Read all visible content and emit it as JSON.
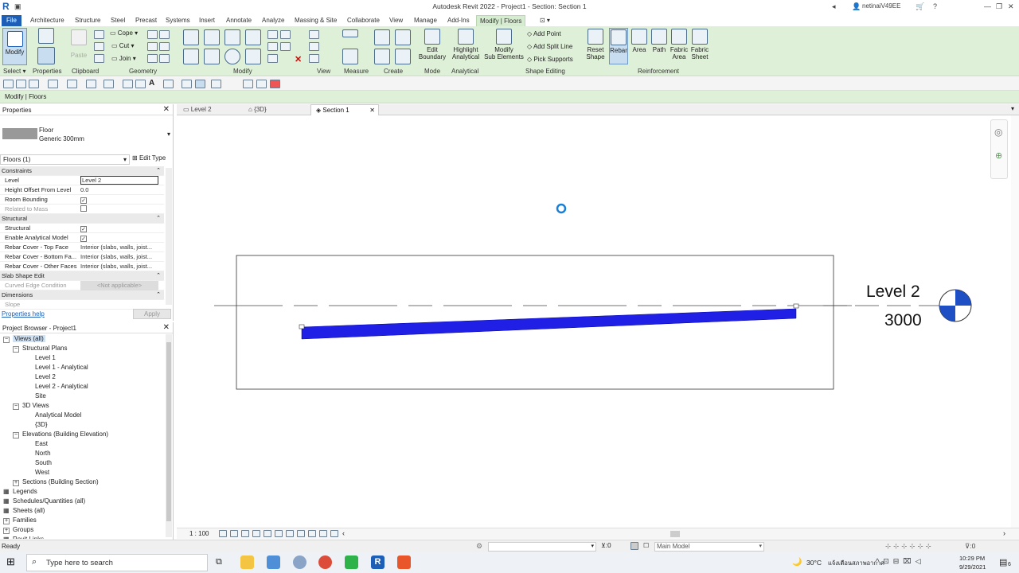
{
  "window": {
    "title": "Autodesk Revit 2022 - Project1 - Section: Section 1",
    "app_logo": "R",
    "user": "netinaiV49EE"
  },
  "menu": {
    "tabs": [
      "File",
      "Architecture",
      "Structure",
      "Steel",
      "Precast",
      "Systems",
      "Insert",
      "Annotate",
      "Analyze",
      "Massing & Site",
      "Collaborate",
      "View",
      "Manage",
      "Add-Ins",
      "Modify | Floors"
    ],
    "active": "Modify | Floors"
  },
  "ribbon": {
    "modify": "Modify",
    "paste": "Paste",
    "cope": "Cope",
    "cut": "Cut",
    "join": "Join",
    "edit_boundary": [
      "Edit",
      "Boundary"
    ],
    "highlight_analytical": [
      "Highlight",
      "Analytical"
    ],
    "modify_sub": [
      "Modify",
      "Sub Elements"
    ],
    "add_point": "Add Point",
    "add_split_line": "Add Split Line",
    "pick_supports": "Pick Supports",
    "reset_shape": [
      "Reset",
      "Shape"
    ],
    "rebar": "Rebar",
    "area": "Area",
    "path": "Path",
    "fabric_area": [
      "Fabric",
      "Area"
    ],
    "fabric_sheet": [
      "Fabric",
      "Sheet"
    ],
    "panels": {
      "select": "Select",
      "properties": "Properties",
      "clipboard": "Clipboard",
      "geometry": "Geometry",
      "modify": "Modify",
      "view": "View",
      "measure": "Measure",
      "create": "Create",
      "mode": "Mode",
      "analytical": "Analytical",
      "shape_editing": "Shape Editing",
      "reinforcement": "Reinforcement"
    }
  },
  "context_bar": "Modify | Floors",
  "properties": {
    "title": "Properties",
    "type_name": "Floor",
    "type_sub": "Generic 300mm",
    "selector": "Floors (1)",
    "edit_type": "Edit Type",
    "rows": [
      {
        "k": "Constraints",
        "group": true
      },
      {
        "k": "Level",
        "v": "Level 2"
      },
      {
        "k": "Height Offset From Level",
        "v": "0.0"
      },
      {
        "k": "Room Bounding",
        "check": true
      },
      {
        "k": "Related to Mass",
        "check": false,
        "dis": true
      },
      {
        "k": "Structural",
        "group": true
      },
      {
        "k": "Structural",
        "check": true
      },
      {
        "k": "Enable Analytical Model",
        "check": true
      },
      {
        "k": "Rebar Cover - Top Face",
        "v": "Interior (slabs, walls, joist..."
      },
      {
        "k": "Rebar Cover - Bottom Fa...",
        "v": "Interior (slabs, walls, joist..."
      },
      {
        "k": "Rebar Cover - Other Faces",
        "v": "Interior (slabs, walls, joist..."
      },
      {
        "k": "Slab Shape Edit",
        "group": true
      },
      {
        "k": "Curved Edge Condition",
        "v": "<Not applicable>",
        "dis": true
      },
      {
        "k": "Dimensions",
        "group": true
      },
      {
        "k": "Slope",
        "v": "",
        "dis": true
      }
    ],
    "help": "Properties help",
    "apply": "Apply"
  },
  "browser": {
    "title": "Project Browser - Project1",
    "items": [
      {
        "label": "Views (all)",
        "indent": 0,
        "tog": "−"
      },
      {
        "label": "Structural Plans",
        "indent": 1,
        "tog": "−"
      },
      {
        "label": "Level 1",
        "indent": 2
      },
      {
        "label": "Level 1 - Analytical",
        "indent": 2
      },
      {
        "label": "Level 2",
        "indent": 2
      },
      {
        "label": "Level 2 - Analytical",
        "indent": 2
      },
      {
        "label": "Site",
        "indent": 2
      },
      {
        "label": "3D Views",
        "indent": 1,
        "tog": "−"
      },
      {
        "label": "Analytical Model",
        "indent": 2
      },
      {
        "label": "{3D}",
        "indent": 2
      },
      {
        "label": "Elevations (Building Elevation)",
        "indent": 1,
        "tog": "−"
      },
      {
        "label": "East",
        "indent": 2
      },
      {
        "label": "North",
        "indent": 2
      },
      {
        "label": "South",
        "indent": 2
      },
      {
        "label": "West",
        "indent": 2
      },
      {
        "label": "Sections (Building Section)",
        "indent": 1,
        "tog": "+"
      },
      {
        "label": "Legends",
        "indent": 0
      },
      {
        "label": "Schedules/Quantities (all)",
        "indent": 0
      },
      {
        "label": "Sheets (all)",
        "indent": 0
      },
      {
        "label": "Families",
        "indent": 0,
        "tog": "+"
      },
      {
        "label": "Groups",
        "indent": 0,
        "tog": "+"
      },
      {
        "label": "Revit Links",
        "indent": 0
      }
    ]
  },
  "view_tabs": [
    {
      "label": "Level 2"
    },
    {
      "label": "{3D}"
    },
    {
      "label": "Section 1",
      "active": true
    }
  ],
  "canvas": {
    "level_name": "Level 2",
    "level_elev": "3000",
    "floor_color": "#1f1fe6"
  },
  "viewbar": {
    "scale": "1 : 100"
  },
  "status": {
    "text": "Ready",
    "coord": ":0",
    "model": "Main Model"
  },
  "taskbar": {
    "search_placeholder": "Type here to search",
    "weather": "30°C",
    "weather_text": "แจ้งเตือนสภาพอากาศ",
    "time": "10:29 PM",
    "date": "9/29/2021",
    "notif": "6"
  }
}
